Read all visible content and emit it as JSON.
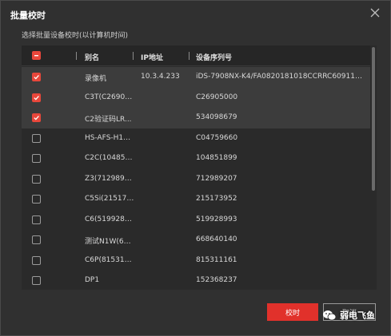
{
  "dialog": {
    "title": "批量校时",
    "subtitle": "选择批量设备校时(以计算机时间)"
  },
  "table": {
    "columns": {
      "alias": "别名",
      "ip": "IP地址",
      "serial": "设备序列号"
    },
    "rows": [
      {
        "checked": true,
        "alias": "录像机",
        "ip": "10.3.4.233",
        "serial": "iDS-7908NX-K4/FA0820181018CCRRC60911848W..."
      },
      {
        "checked": true,
        "alias": "C3T(C26905...",
        "ip": "",
        "serial": "C26905000"
      },
      {
        "checked": true,
        "alias": "C2验证码LR...",
        "ip": "",
        "serial": "534098679"
      },
      {
        "checked": false,
        "alias": "HS-AFS-H10...",
        "ip": "",
        "serial": "C04759660"
      },
      {
        "checked": false,
        "alias": "C2C(104851...",
        "ip": "",
        "serial": "104851899"
      },
      {
        "checked": false,
        "alias": "Z3(7129892...",
        "ip": "",
        "serial": "712989207"
      },
      {
        "checked": false,
        "alias": "C5Si(215173...",
        "ip": "",
        "serial": "215173952"
      },
      {
        "checked": false,
        "alias": "C6(5199289...",
        "ip": "",
        "serial": "519928993"
      },
      {
        "checked": false,
        "alias": "测试N1W(66...",
        "ip": "",
        "serial": "668640140"
      },
      {
        "checked": false,
        "alias": "C6P(815311...",
        "ip": "",
        "serial": "815311161"
      },
      {
        "checked": false,
        "alias": "DP1",
        "ip": "",
        "serial": "152368237"
      }
    ]
  },
  "buttons": {
    "ok": "校时",
    "cancel": "取消"
  },
  "watermark": {
    "text": "弱电飞鱼",
    "icon": "wechat-icon"
  },
  "colors": {
    "accent": "#e1312b",
    "checkbox": "#e8473b",
    "background": "#303030"
  }
}
